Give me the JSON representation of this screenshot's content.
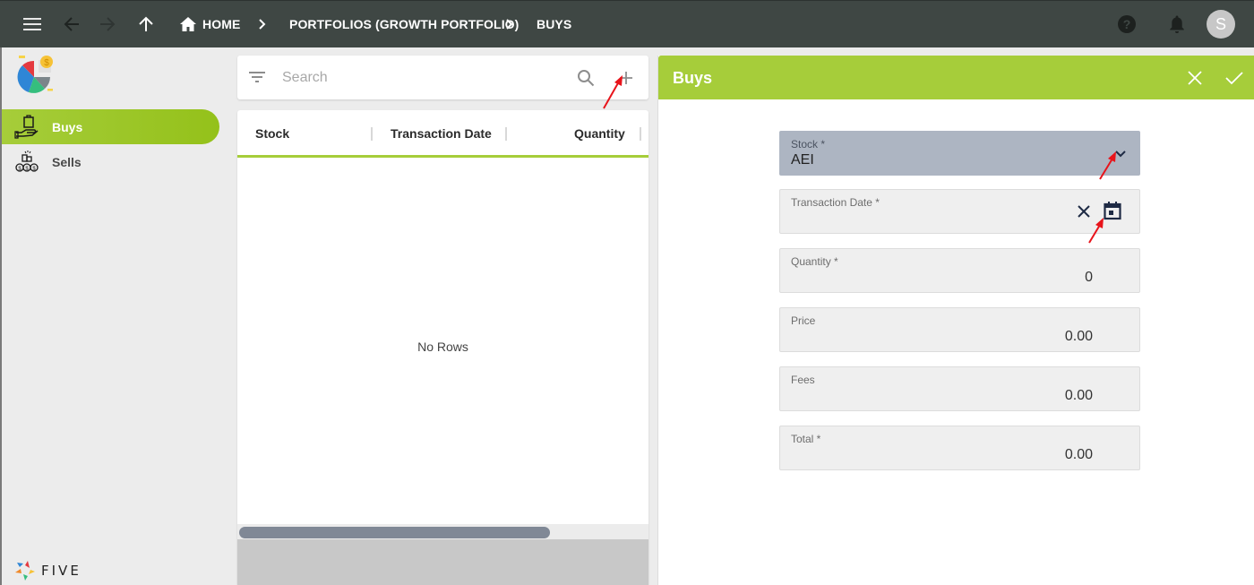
{
  "topbar": {
    "breadcrumbs": [
      {
        "label": "HOME"
      },
      {
        "label": "PORTFOLIOS (GROWTH PORTFOLIO)"
      },
      {
        "label": "BUYS"
      }
    ],
    "avatar_initial": "S",
    "icons": [
      "menu-icon",
      "back-arrow-icon",
      "forward-arrow-icon",
      "up-arrow-icon",
      "home-icon",
      "help-icon",
      "notifications-bell-icon"
    ]
  },
  "sidebar": {
    "items": [
      {
        "label": "Buys",
        "icon": "buy-hand-bag-icon",
        "active": true
      },
      {
        "label": "Sells",
        "icon": "sell-coins-icon",
        "active": false
      }
    ],
    "footer_logo_text": "FIVE"
  },
  "list": {
    "search_placeholder": "Search",
    "columns": [
      "Stock",
      "Transaction Date",
      "Quantity"
    ],
    "rows": [],
    "empty_text": "No Rows"
  },
  "form": {
    "title": "Buys",
    "fields": [
      {
        "label": "Stock *",
        "value": "AEI",
        "type": "select"
      },
      {
        "label": "Transaction Date *",
        "value": "",
        "type": "date"
      },
      {
        "label": "Quantity *",
        "value": "0",
        "type": "number"
      },
      {
        "label": "Price",
        "value": "0.00",
        "type": "number"
      },
      {
        "label": "Fees",
        "value": "0.00",
        "type": "number"
      },
      {
        "label": "Total *",
        "value": "0.00",
        "type": "number"
      }
    ]
  },
  "colors": {
    "accent": "#a6cd3a",
    "topbar": "#3f4744",
    "select_field": "#adb5c2",
    "annotation_arrow": "#e8141b"
  }
}
